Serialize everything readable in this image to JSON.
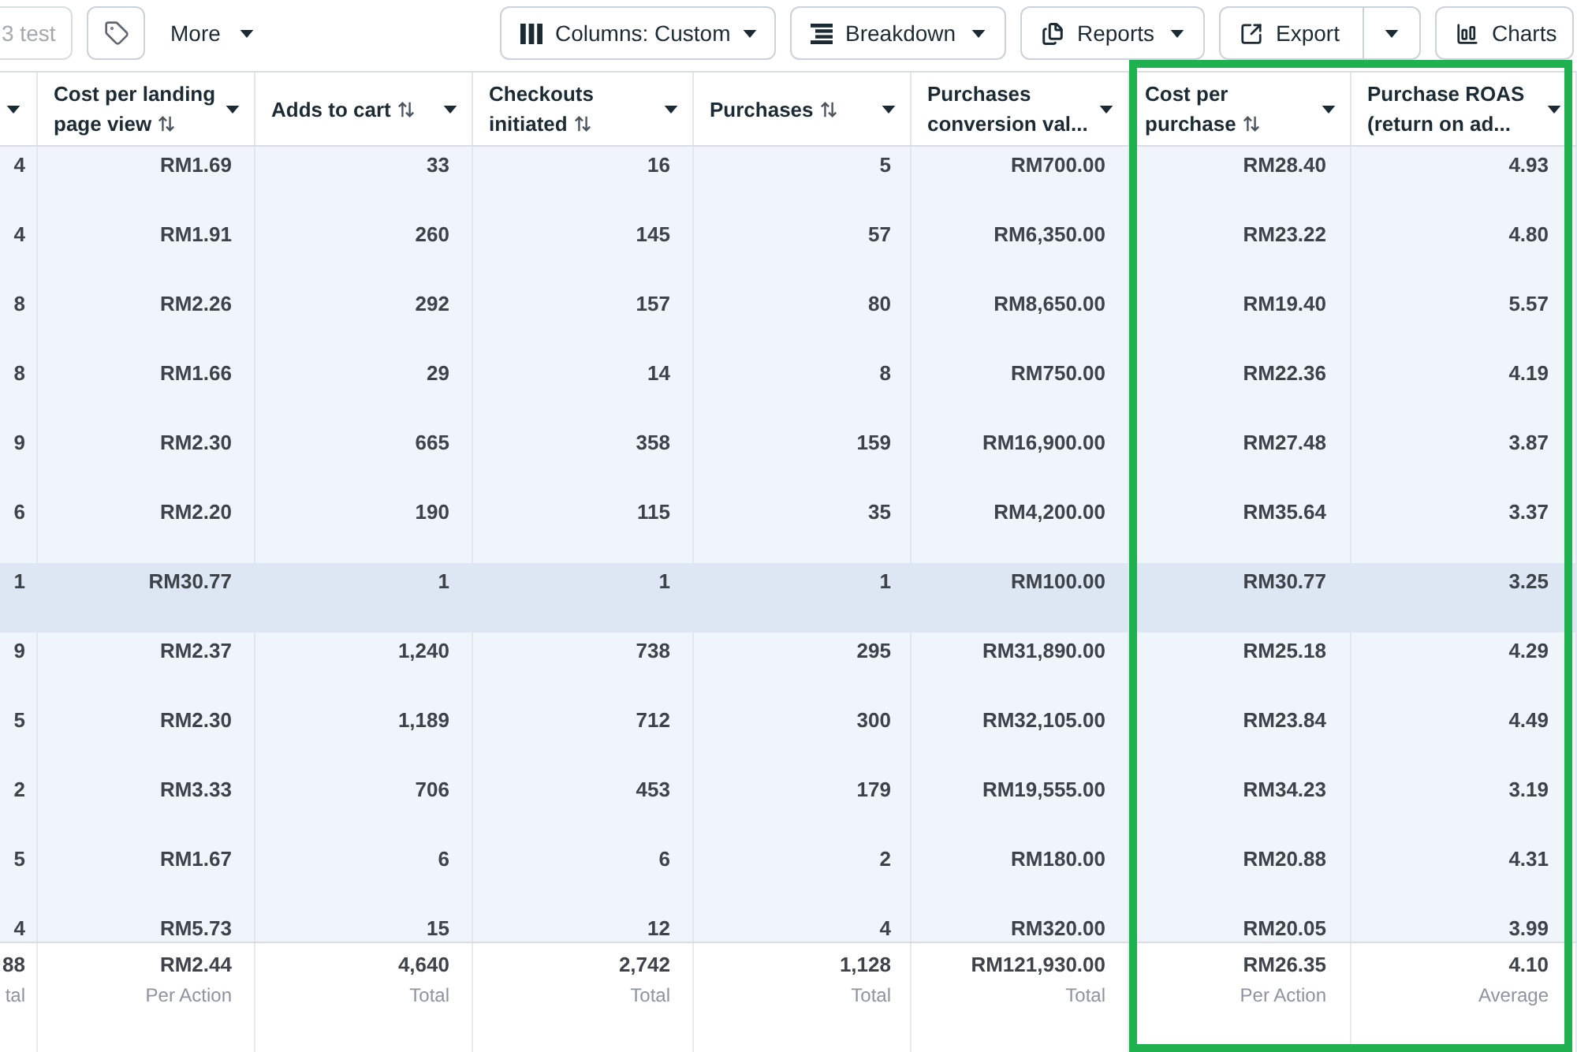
{
  "toolbar": {
    "cut_button": {
      "label": "3 test",
      "disabled": true
    },
    "more_menu": {
      "label": "More"
    },
    "buttons": [
      {
        "kind": "dropdown",
        "label": "Columns: Custom"
      },
      {
        "kind": "dropdown",
        "label": "Breakdown"
      },
      {
        "kind": "dropdown",
        "label": "Reports"
      },
      {
        "kind": "split",
        "label": "Export"
      },
      {
        "kind": "plain",
        "label": "Charts"
      }
    ]
  },
  "table": {
    "columns": [
      {
        "menu": true
      },
      {
        "label": "Cost per landing page view",
        "sortable": true,
        "outlined": false,
        "menu": true
      },
      {
        "label": "Adds to cart",
        "sortable": true,
        "outlined": false,
        "menu": true
      },
      {
        "label": "Checkouts initiated",
        "sortable": true,
        "outlined": false,
        "menu": true
      },
      {
        "label": "Purchases",
        "sortable": true,
        "outlined": false,
        "menu": true
      },
      {
        "label": "Purchases conversion val...",
        "sortable": false,
        "outlined": false,
        "menu": true
      },
      {
        "label": "Cost per purchase",
        "sortable": true,
        "outlined": true,
        "menu": true
      },
      {
        "label": "Purchase ROAS (return on ad...",
        "sortable": false,
        "outlined": true,
        "menu": true
      }
    ],
    "rows": [
      {
        "selected": false,
        "cells": [
          "4",
          "RM1.69",
          "33",
          "16",
          "5",
          "RM700.00",
          "RM28.40",
          "4.93"
        ]
      },
      {
        "selected": false,
        "cells": [
          "4",
          "RM1.91",
          "260",
          "145",
          "57",
          "RM6,350.00",
          "RM23.22",
          "4.80"
        ]
      },
      {
        "selected": false,
        "cells": [
          "8",
          "RM2.26",
          "292",
          "157",
          "80",
          "RM8,650.00",
          "RM19.40",
          "5.57"
        ]
      },
      {
        "selected": false,
        "cells": [
          "8",
          "RM1.66",
          "29",
          "14",
          "8",
          "RM750.00",
          "RM22.36",
          "4.19"
        ]
      },
      {
        "selected": false,
        "cells": [
          "9",
          "RM2.30",
          "665",
          "358",
          "159",
          "RM16,900.00",
          "RM27.48",
          "3.87"
        ]
      },
      {
        "selected": false,
        "cells": [
          "6",
          "RM2.20",
          "190",
          "115",
          "35",
          "RM4,200.00",
          "RM35.64",
          "3.37"
        ]
      },
      {
        "selected": true,
        "cells": [
          "1",
          "RM30.77",
          "1",
          "1",
          "1",
          "RM100.00",
          "RM30.77",
          "3.25"
        ]
      },
      {
        "selected": false,
        "cells": [
          "9",
          "RM2.37",
          "1,240",
          "738",
          "295",
          "RM31,890.00",
          "RM25.18",
          "4.29"
        ]
      },
      {
        "selected": false,
        "cells": [
          "5",
          "RM2.30",
          "1,189",
          "712",
          "300",
          "RM32,105.00",
          "RM23.84",
          "4.49"
        ]
      },
      {
        "selected": false,
        "cells": [
          "2",
          "RM3.33",
          "706",
          "453",
          "179",
          "RM19,555.00",
          "RM34.23",
          "3.19"
        ]
      },
      {
        "selected": false,
        "cells": [
          "5",
          "RM1.67",
          "6",
          "6",
          "2",
          "RM180.00",
          "RM20.88",
          "4.31"
        ]
      },
      {
        "selected": false,
        "cells": [
          "4",
          "RM5.73",
          "15",
          "12",
          "4",
          "RM320.00",
          "RM20.05",
          "3.99"
        ]
      }
    ],
    "totals": [
      {
        "value": "88",
        "label": "tal"
      },
      {
        "value": "RM2.44",
        "label": "Per Action"
      },
      {
        "value": "4,640",
        "label": "Total"
      },
      {
        "value": "2,742",
        "label": "Total"
      },
      {
        "value": "1,128",
        "label": "Total"
      },
      {
        "value": "RM121,930.00",
        "label": "Total"
      },
      {
        "value": "RM26.35",
        "label": "Per Action"
      },
      {
        "value": "4.10",
        "label": "Average"
      }
    ]
  }
}
